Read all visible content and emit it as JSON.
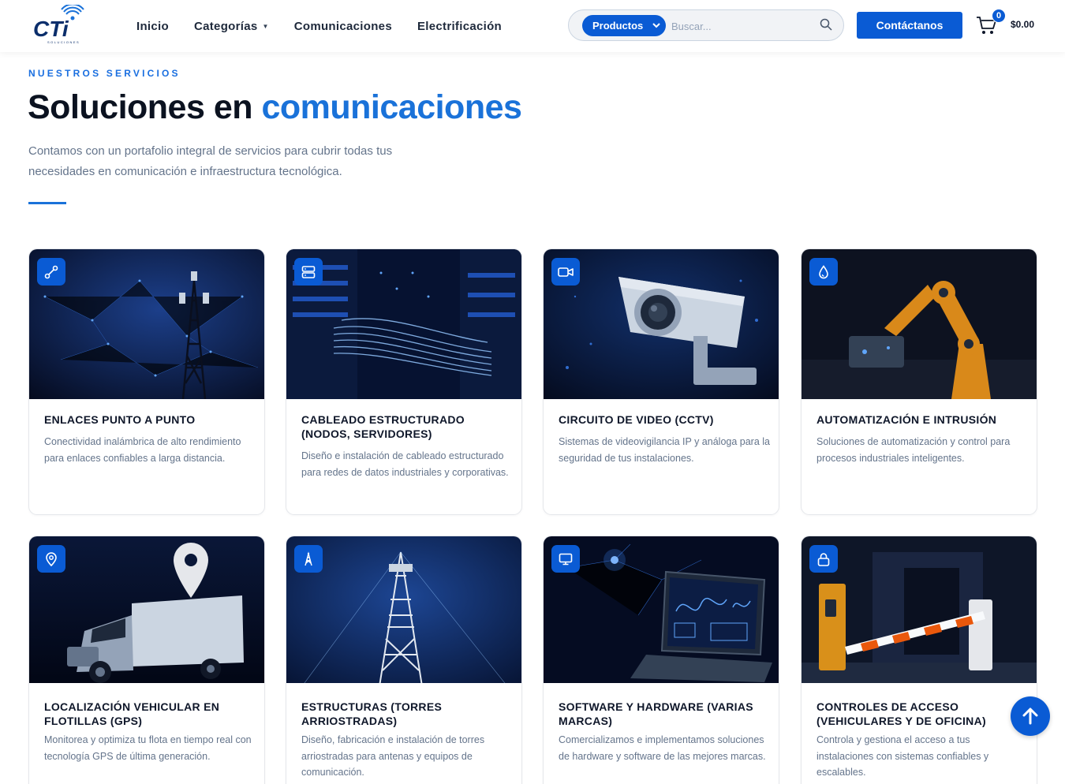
{
  "header": {
    "logo_text": "CTi",
    "logo_subtext": "SOLUCIONES",
    "nav": [
      {
        "label": "Inicio"
      },
      {
        "label": "Categorías"
      },
      {
        "label": "Comunicaciones"
      },
      {
        "label": "Electrificación"
      }
    ],
    "search": {
      "category": "Productos",
      "placeholder": "Buscar..."
    },
    "contact_label": "Contáctanos",
    "cart": {
      "count": "0",
      "total": "$0.00"
    }
  },
  "hero": {
    "eyebrow": "NUESTROS SERVICIOS",
    "title_part1": "Soluciones en ",
    "title_part2": "comunicaciones",
    "description": "Contamos con un portafolio integral de servicios para cubrir todas tus necesidades en comunicación e infraestructura tecnológica."
  },
  "services": [
    {
      "title": "ENLACES PUNTO A PUNTO",
      "text": "Conectividad inalámbrica de alto rendimiento para enlaces confiables a larga distancia.",
      "icon": "link-icon"
    },
    {
      "title": "CABLEADO ESTRUCTURADO (NODOS, SERVIDORES)",
      "text": "Diseño e instalación de cableado estructurado para redes de datos industriales y corporativas.",
      "icon": "server-icon"
    },
    {
      "title": "CIRCUITO DE VIDEO (CCTV)",
      "text": "Sistemas de videovigilancia IP y análoga para la seguridad de tus instalaciones.",
      "icon": "video-camera-icon"
    },
    {
      "title": "AUTOMATIZACIÓN E INTRUSIÓN",
      "text": "Soluciones de automatización y control para procesos industriales inteligentes.",
      "icon": "droplet-icon"
    },
    {
      "title": "LOCALIZACIÓN VEHICULAR EN FLOTILLAS (GPS)",
      "text": "Monitorea y optimiza tu flota en tiempo real con tecnología GPS de última generación.",
      "icon": "map-pin-icon"
    },
    {
      "title": "ESTRUCTURAS (TORRES ARRIOSTRADAS)",
      "text": "Diseño, fabricación e instalación de torres arriostradas para antenas y equipos de comunicación.",
      "icon": "tower-icon"
    },
    {
      "title": "SOFTWARE Y HARDWARE (VARIAS MARCAS)",
      "text": "Comercializamos e implementamos soluciones de hardware y software de las mejores marcas.",
      "icon": "monitor-icon"
    },
    {
      "title": "CONTROLES DE ACCESO (VEHICULARES Y DE OFICINA)",
      "text": "Controla y gestiona el acceso a tus instalaciones con sistemas confiables y escalables.",
      "icon": "lock-icon"
    }
  ],
  "colors": {
    "primary": "#0a5bd4",
    "accent": "#1a72d9",
    "dark": "#0b1220"
  }
}
